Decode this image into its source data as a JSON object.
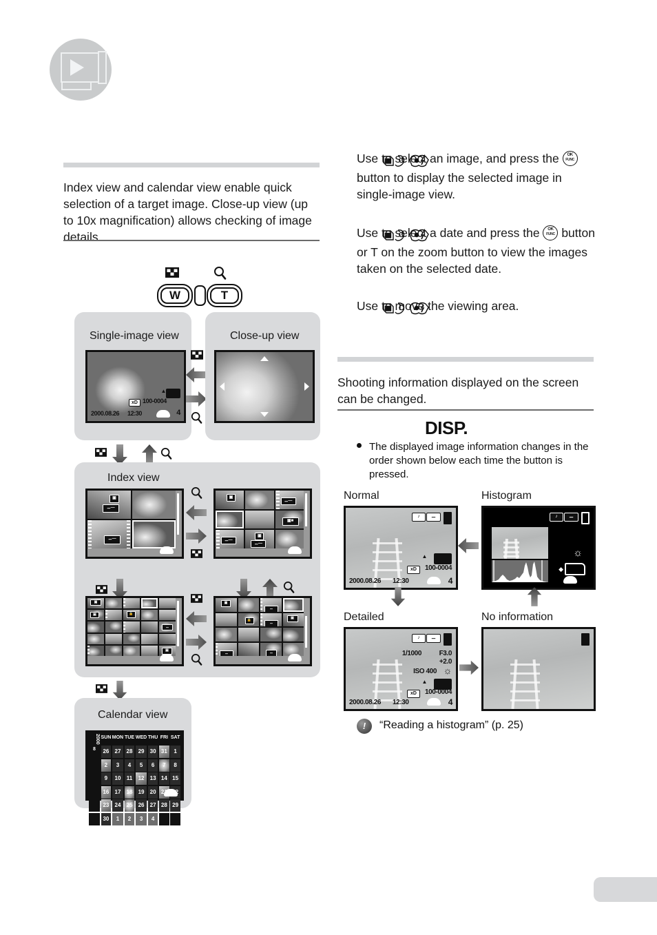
{
  "page": {
    "playback_icon": "playback-monitor-icon"
  },
  "intro": {
    "text": "Index view and calendar view enable quick selection of a target image. Close-up view (up to 10x magnification) allows checking of image details."
  },
  "instructions": [
    {
      "id": "select-image",
      "before_pad": "Use ",
      "after_pad": " to select an image, and press the ",
      "after_ok": " button to display the selected image in single-image view."
    },
    {
      "id": "select-date",
      "before_pad": "Use ",
      "after_pad": " to select a date and press the ",
      "after_ok": " button or T on the zoom button to view the images taken on the selected date."
    },
    {
      "id": "move-viewing-area",
      "before_pad": "Use ",
      "after_pad": " to move the viewing area.",
      "after_ok": ""
    }
  ],
  "zoom_button": {
    "wide_label": "W",
    "tele_label": "T",
    "index_icon": "index-checkered-icon",
    "magnify_icon": "magnifier-icon"
  },
  "view_panels": {
    "single_image": "Single-image view",
    "close_up": "Close-up view",
    "index": "Index view",
    "calendar": "Calendar view"
  },
  "lcd_single": {
    "date": "2000.08.26",
    "time": "12:30",
    "file_no": "100-0004",
    "frame_no": "4",
    "card_tag": "xD",
    "battery_icon": "battery-icon",
    "folder_icon": "folder-icon"
  },
  "disp_section": {
    "intro": "Shooting information displayed on the screen can be changed.",
    "title": "DISP.",
    "bullet": "The displayed image information changes in the order shown below each time the button is pressed.",
    "modes": {
      "normal": "Normal",
      "histogram": "Histogram",
      "detailed": "Detailed",
      "no_information": "No information"
    }
  },
  "lcd_normal": {
    "date": "2000.08.26",
    "time": "12:30",
    "file_no": "100-0004",
    "frame_no": "4",
    "card_tag": "xD",
    "sound_tag": "sound-icon",
    "protect_tag": "protect-key-icon"
  },
  "lcd_detailed": {
    "shutter_speed": "1/1000",
    "aperture": "F3.0",
    "exposure_comp": "+2.0",
    "iso": "ISO 400",
    "white_balance": "sunny-wb-icon",
    "date": "2000.08.26",
    "time": "12:30",
    "file_no": "100-0004",
    "frame_no": "4",
    "card_tag": "xD"
  },
  "lcd_histogram": {
    "sound_tag": "sound-icon",
    "protect_tag": "protect-key-icon",
    "brightness_icon": "brightness-icon",
    "card_icon": "card-icon"
  },
  "calendar": {
    "year": "2000",
    "month": "8",
    "weekday_headers": [
      "SUN",
      "MON",
      "TUE",
      "WED",
      "THU",
      "FRI",
      "SAT"
    ],
    "weeks": [
      [
        "26",
        "27",
        "28",
        "29",
        "30",
        "31",
        "1"
      ],
      [
        "2",
        "3",
        "4",
        "5",
        "6",
        "7",
        "8"
      ],
      [
        "9",
        "10",
        "11",
        "12",
        "13",
        "14",
        "15"
      ],
      [
        "16",
        "17",
        "18",
        "19",
        "20",
        "21",
        "22"
      ],
      [
        "23",
        "24",
        "25",
        "26",
        "27",
        "28",
        "29"
      ],
      [
        "30",
        "1",
        "2",
        "3",
        "4",
        "",
        ""
      ]
    ]
  },
  "footnote": {
    "icon": "note-exclamation-icon",
    "text": "“Reading a histogram” (p. 25)"
  }
}
